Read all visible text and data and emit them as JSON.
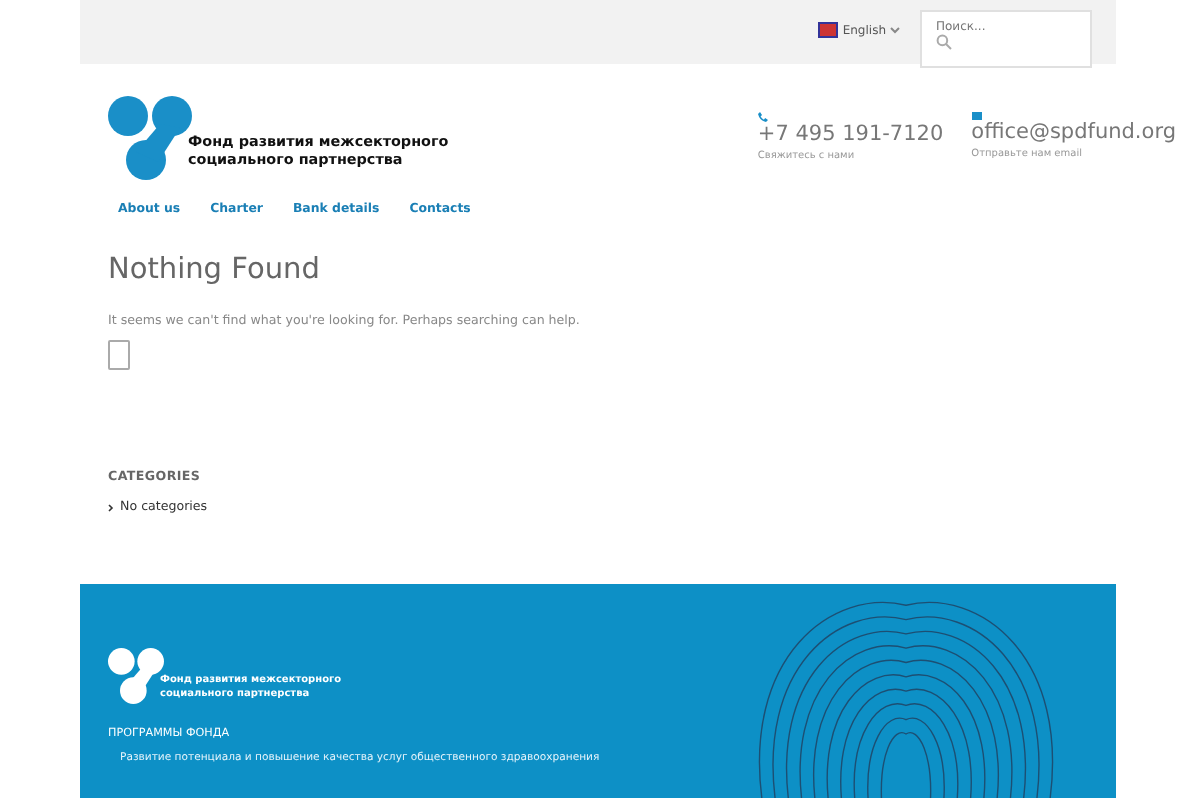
{
  "top_bar": {
    "language": "English",
    "search": {
      "placeholder": "Поиск..."
    }
  },
  "header": {
    "logo_lines": [
      "Фонд развития межсекторного",
      "социального партнерства"
    ],
    "contacts": [
      {
        "kind": "phone",
        "value": "+7 495 191-7120",
        "caption": "Свяжитесь с нами"
      },
      {
        "kind": "email",
        "value": "office@spdfund.org",
        "caption": "Отправьте нам email"
      }
    ]
  },
  "nav": [
    "About us",
    "Charter",
    "Bank details",
    "Contacts"
  ],
  "content": {
    "title": "Nothing Found",
    "message": "It seems we can't find what you're looking for. Perhaps searching can help."
  },
  "sidebar": {
    "heading": "CATEGORIES",
    "items": [
      "No categories"
    ]
  },
  "footer": {
    "logo_lines": [
      "Фонд развития межсекторного",
      "социального партнерства"
    ],
    "heading": "ПРОГРАММЫ ФОНДА",
    "items": [
      "Развитие потенциала и повышение качества услуг общественного здравоохранения"
    ]
  }
}
